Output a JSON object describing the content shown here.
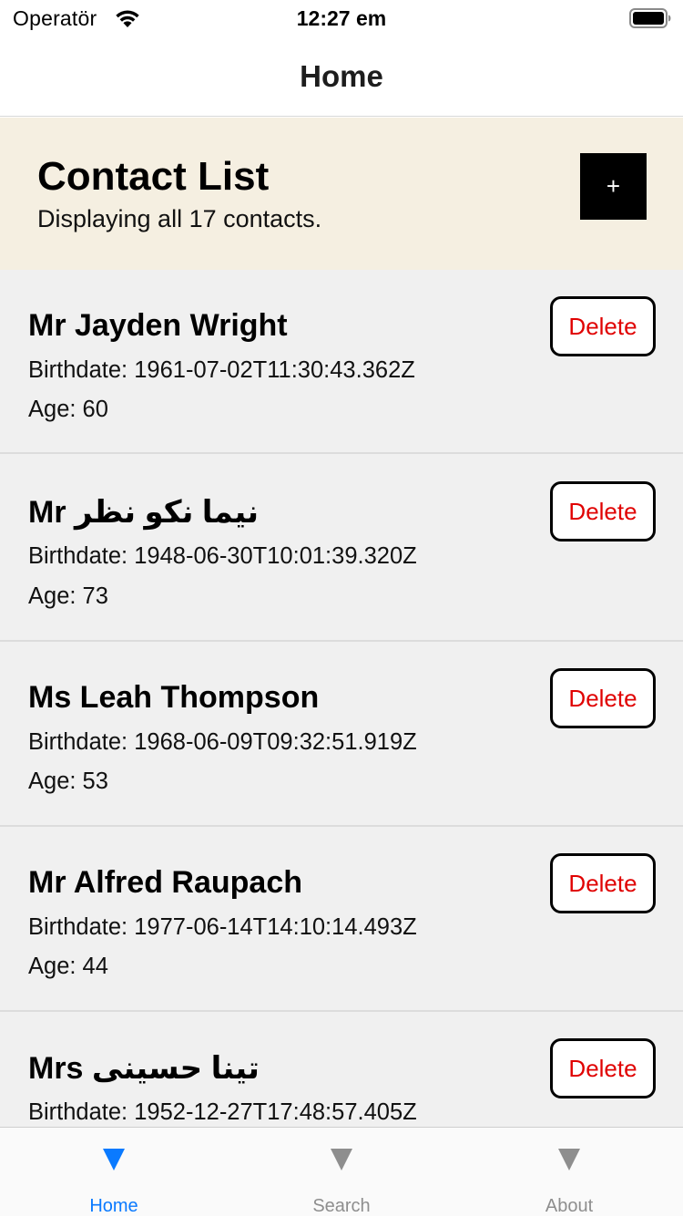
{
  "status_bar": {
    "carrier": "Operatör",
    "time": "12:27 em"
  },
  "nav": {
    "title": "Home"
  },
  "header": {
    "title": "Contact List",
    "subtitle": "Displaying all 17 contacts.",
    "add_label": "+"
  },
  "contacts": [
    {
      "name": "Mr Jayden Wright",
      "birthdate": "Birthdate: 1961-07-02T11:30:43.362Z",
      "age": "Age: 60",
      "delete_label": "Delete"
    },
    {
      "name": "Mr نیما نکو نظر",
      "birthdate": "Birthdate: 1948-06-30T10:01:39.320Z",
      "age": "Age: 73",
      "delete_label": "Delete"
    },
    {
      "name": "Ms Leah Thompson",
      "birthdate": "Birthdate: 1968-06-09T09:32:51.919Z",
      "age": "Age: 53",
      "delete_label": "Delete"
    },
    {
      "name": "Mr Alfred Raupach",
      "birthdate": "Birthdate: 1977-06-14T14:10:14.493Z",
      "age": "Age: 44",
      "delete_label": "Delete"
    },
    {
      "name": "Mrs تینا حسینی",
      "birthdate": "Birthdate: 1952-12-27T17:48:57.405Z",
      "age": "",
      "delete_label": "Delete"
    }
  ],
  "tabs": [
    {
      "label": "Home",
      "icon": "triangle-down-icon",
      "color": "#0a7aff",
      "active": true
    },
    {
      "label": "Search",
      "icon": "triangle-down-icon",
      "color": "#8e8e8e",
      "active": false
    },
    {
      "label": "About",
      "icon": "triangle-down-icon",
      "color": "#8e8e8e",
      "active": false
    }
  ],
  "colors": {
    "header_bg": "#f5efe1",
    "list_bg": "#f0f0f0",
    "delete_text": "#e00000",
    "tab_active": "#0a7aff",
    "tab_inactive": "#8e8e8e"
  }
}
